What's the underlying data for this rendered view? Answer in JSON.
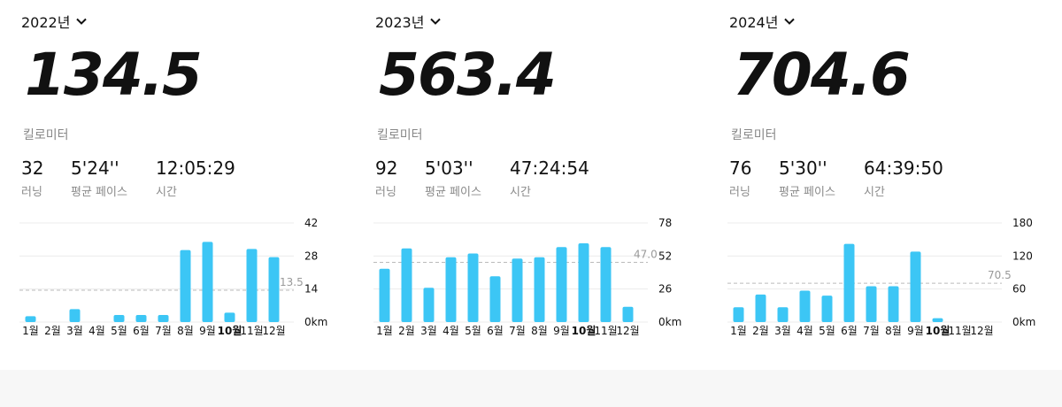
{
  "accent": "#3cc6f5",
  "panels": [
    {
      "year": "2022년",
      "total": "134.5",
      "unit": "킬로미터",
      "runs": "32",
      "runs_label": "러닝",
      "pace": "5'24''",
      "pace_label": "평균 페이스",
      "time": "12:05:29",
      "time_label": "시간",
      "chart_data": {
        "type": "bar",
        "categories": [
          "1월",
          "2월",
          "3월",
          "4월",
          "5월",
          "6월",
          "7월",
          "8월",
          "9월",
          "10월",
          "11월",
          "12월"
        ],
        "values": [
          2.5,
          0,
          5.5,
          0,
          3,
          3,
          3,
          30.5,
          34,
          4,
          31,
          27.5
        ],
        "ylim": [
          0,
          42
        ],
        "yticks": [
          "0km",
          "14",
          "28",
          "42"
        ],
        "average": 13.5,
        "average_label": "13.5",
        "highlight": "10월"
      }
    },
    {
      "year": "2023년",
      "total": "563.4",
      "unit": "킬로미터",
      "runs": "92",
      "runs_label": "러닝",
      "pace": "5'03''",
      "pace_label": "평균 페이스",
      "time": "47:24:54",
      "time_label": "시간",
      "chart_data": {
        "type": "bar",
        "categories": [
          "1월",
          "2월",
          "3월",
          "4월",
          "5월",
          "6월",
          "7월",
          "8월",
          "9월",
          "10월",
          "11월",
          "12월"
        ],
        "values": [
          42,
          58,
          27,
          51,
          54,
          36,
          50,
          51,
          59,
          62,
          59,
          12
        ],
        "ylim": [
          0,
          78
        ],
        "yticks": [
          "0km",
          "26",
          "52",
          "78"
        ],
        "average": 47.0,
        "average_label": "47.0",
        "highlight": "10월"
      }
    },
    {
      "year": "2024년",
      "total": "704.6",
      "unit": "킬로미터",
      "runs": "76",
      "runs_label": "러닝",
      "pace": "5'30''",
      "pace_label": "평균 페이스",
      "time": "64:39:50",
      "time_label": "시간",
      "chart_data": {
        "type": "bar",
        "categories": [
          "1월",
          "2월",
          "3월",
          "4월",
          "5월",
          "6월",
          "7월",
          "8월",
          "9월",
          "10월",
          "11월",
          "12월"
        ],
        "values": [
          27,
          50,
          27,
          57,
          48,
          142,
          65,
          65,
          128,
          7,
          0,
          0
        ],
        "ylim": [
          0,
          180
        ],
        "yticks": [
          "0km",
          "60",
          "120",
          "180"
        ],
        "average": 70.5,
        "average_label": "70.5",
        "highlight": "10월"
      }
    }
  ]
}
